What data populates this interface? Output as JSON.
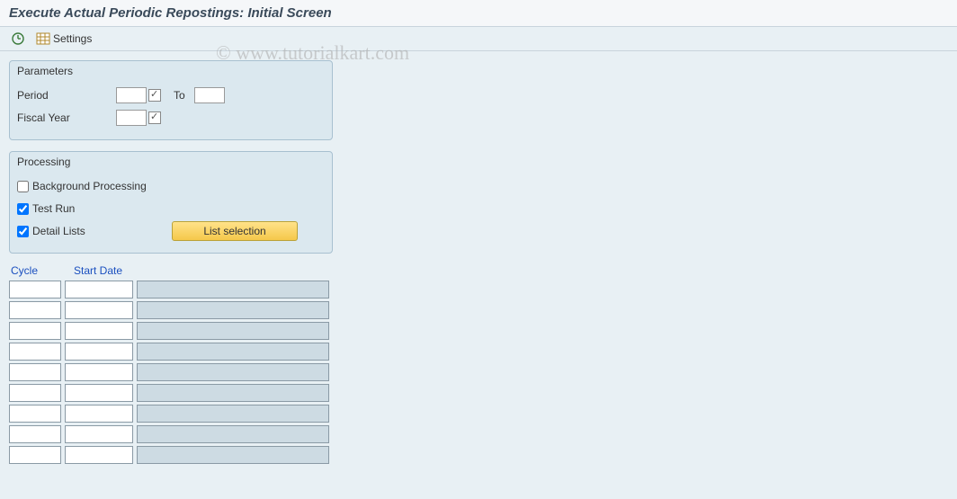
{
  "header": {
    "title": "Execute Actual Periodic Repostings: Initial Screen"
  },
  "toolbar": {
    "execute_icon": "execute",
    "settings_label": "Settings"
  },
  "parameters": {
    "legend": "Parameters",
    "period_label": "Period",
    "to_label": "To",
    "fiscal_year_label": "Fiscal Year",
    "period_value": "",
    "period_to_value": "",
    "fiscal_year_value": ""
  },
  "processing": {
    "legend": "Processing",
    "background_label": "Background Processing",
    "background_checked": false,
    "testrun_label": "Test Run",
    "testrun_checked": true,
    "detail_lists_label": "Detail Lists",
    "detail_lists_checked": true,
    "list_selection_label": "List selection"
  },
  "table": {
    "col_cycle": "Cycle",
    "col_start_date": "Start Date",
    "rows": [
      {
        "cycle": "",
        "start_date": "",
        "desc": ""
      },
      {
        "cycle": "",
        "start_date": "",
        "desc": ""
      },
      {
        "cycle": "",
        "start_date": "",
        "desc": ""
      },
      {
        "cycle": "",
        "start_date": "",
        "desc": ""
      },
      {
        "cycle": "",
        "start_date": "",
        "desc": ""
      },
      {
        "cycle": "",
        "start_date": "",
        "desc": ""
      },
      {
        "cycle": "",
        "start_date": "",
        "desc": ""
      },
      {
        "cycle": "",
        "start_date": "",
        "desc": ""
      },
      {
        "cycle": "",
        "start_date": "",
        "desc": ""
      }
    ]
  },
  "watermark": "© www.tutorialkart.com"
}
